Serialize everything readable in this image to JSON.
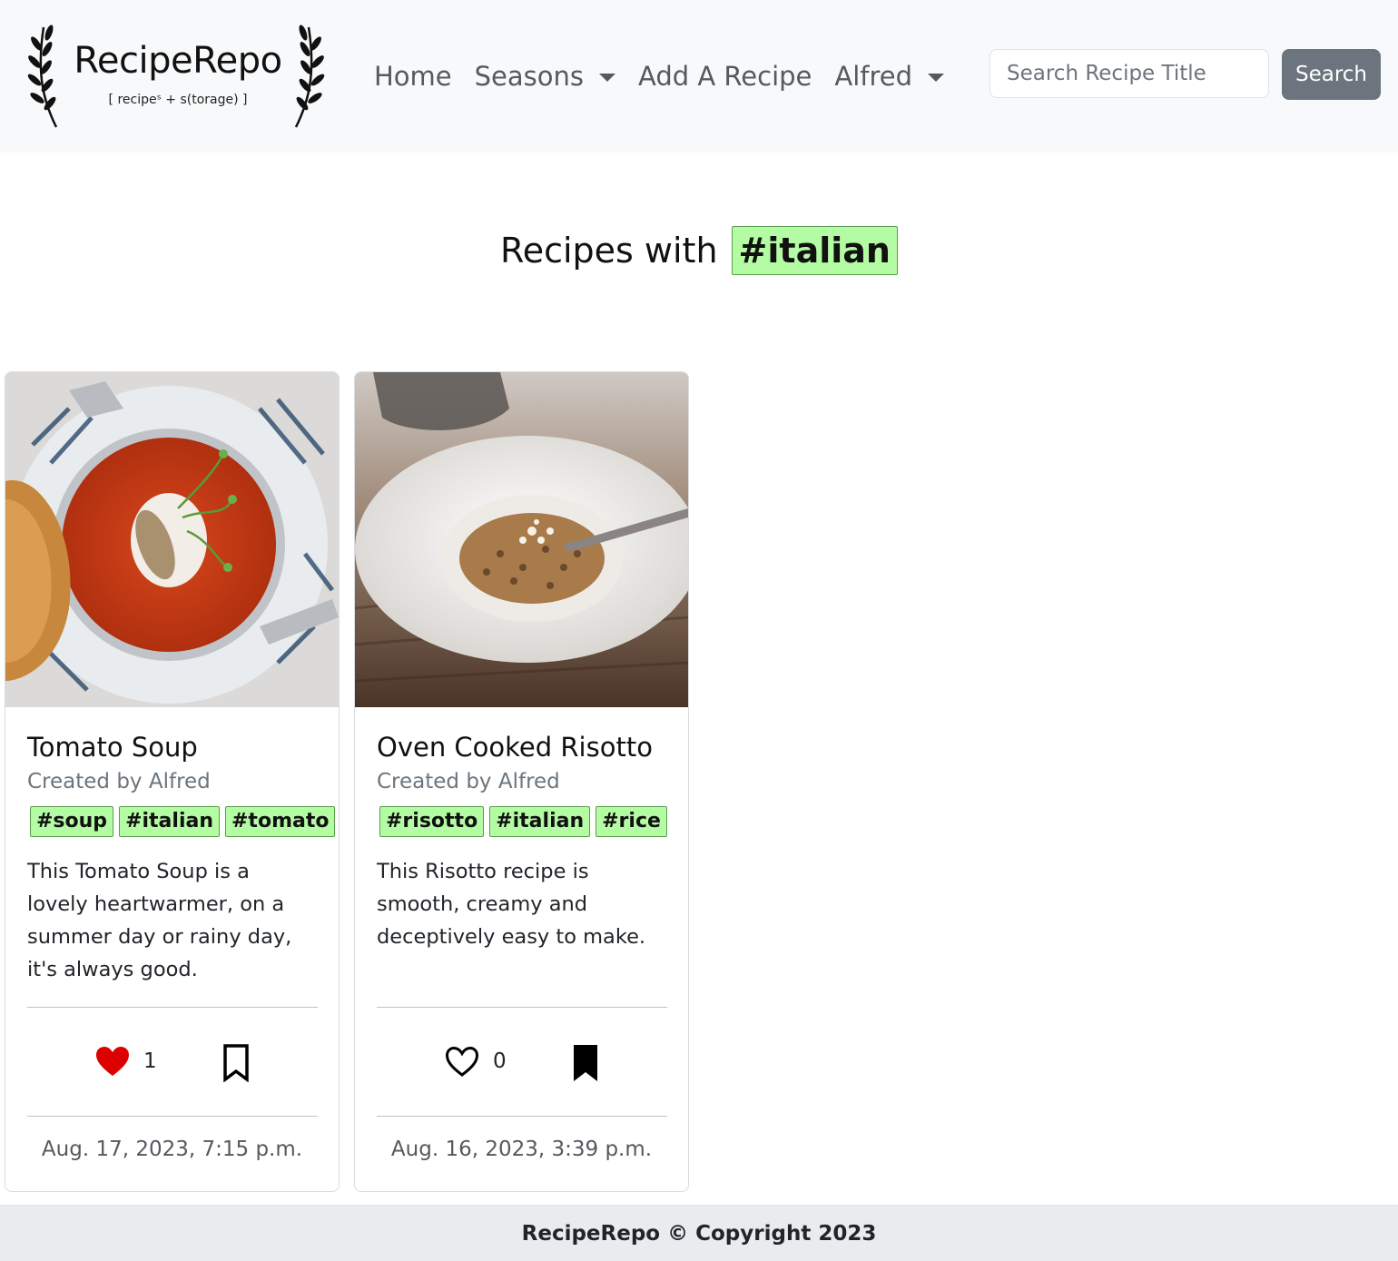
{
  "navbar": {
    "brand_name": "RecipeRepo",
    "brand_tagline": "[ recipeˢ + s(torage) ]",
    "links": {
      "home": "Home",
      "seasons": "Seasons",
      "add_recipe": "Add A Recipe",
      "user": "Alfred"
    },
    "search": {
      "placeholder": "Search Recipe Title",
      "button_label": "Search"
    }
  },
  "heading": {
    "text": "Recipes with",
    "tag": "#italian"
  },
  "cards": [
    {
      "title": "Tomato Soup",
      "author": "Created by Alfred",
      "tags": [
        "#soup",
        "#italian",
        "#tomato"
      ],
      "description": "This Tomato Soup is a lovely heartwarmer, on a summer day or rainy day, it's always good.",
      "likes": "1",
      "liked": true,
      "bookmarked": false,
      "date": "Aug. 17, 2023, 7:15 p.m."
    },
    {
      "title": "Oven Cooked Risotto",
      "author": "Created by Alfred",
      "tags": [
        "#risotto",
        "#italian",
        "#rice"
      ],
      "description": "This Risotto recipe is smooth, creamy and deceptively easy to make.",
      "likes": "0",
      "liked": false,
      "bookmarked": true,
      "date": "Aug. 16, 2023, 3:39 p.m."
    }
  ],
  "footer": {
    "text": "RecipeRepo © Copyright 2023"
  },
  "colors": {
    "navbar_bg": "#f8f9fa",
    "tag_bg": "#b4fca4",
    "tag_border": "#5a9e4c",
    "search_button_bg": "#6c757d",
    "heart_liked": "#dd0000",
    "footer_bg": "#e9ecef"
  },
  "icons": {
    "like_filled": "heart-filled-icon",
    "like_outline": "heart-outline-icon",
    "bookmark_filled": "bookmark-filled-icon",
    "bookmark_outline": "bookmark-outline-icon",
    "caret": "caret-down-icon",
    "laurel": "laurel-icon"
  }
}
